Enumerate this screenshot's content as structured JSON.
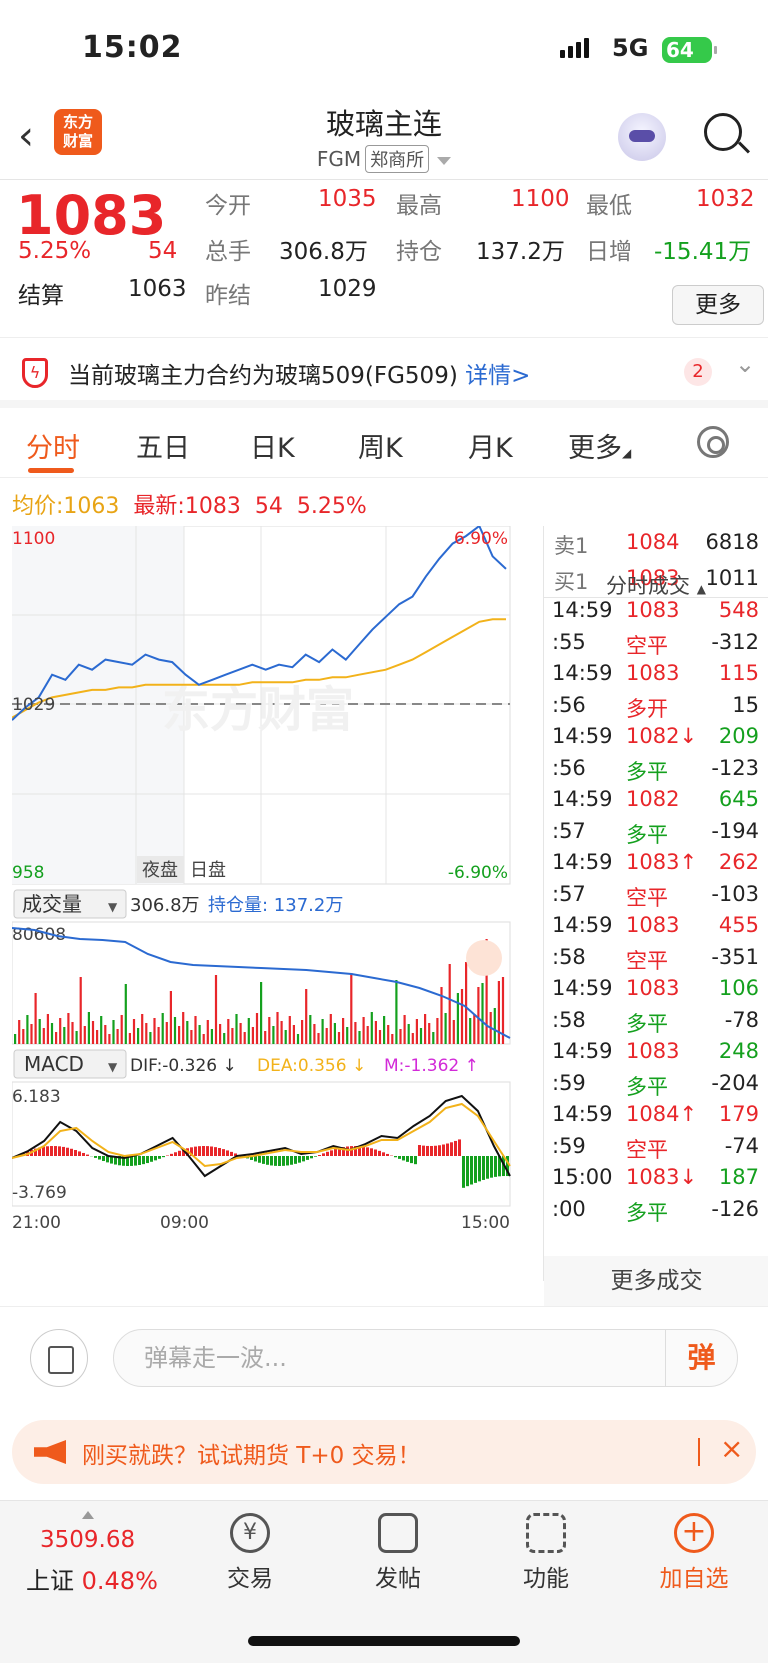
{
  "status": {
    "time": "15:02",
    "network": "5G",
    "battery": "64"
  },
  "header": {
    "logo_line1": "东方",
    "logo_line2": "财富",
    "title": "玻璃主连",
    "code": "FGM",
    "exchange": "郑商所"
  },
  "quote": {
    "price": "1083",
    "change_pct": "5.25%",
    "change": "54",
    "open_label": "今开",
    "open": "1035",
    "high_label": "最高",
    "high": "1100",
    "low_label": "最低",
    "low": "1032",
    "volume_label": "总手",
    "volume": "306.8万",
    "oi_label": "持仓",
    "oi": "137.2万",
    "daily_inc_label": "日增",
    "daily_inc": "-15.41万",
    "settle_label": "结算",
    "settle": "1063",
    "prev_settle_label": "昨结",
    "prev_settle": "1029",
    "more_label": "更多"
  },
  "notice": {
    "text": "当前玻璃主力合约为玻璃509(FG509)",
    "link": "详情>",
    "badge": "2"
  },
  "tabs": [
    "分时",
    "五日",
    "日K",
    "周K",
    "月K",
    "更多"
  ],
  "infoline": {
    "avg_label": "均价:",
    "avg": "1063",
    "latest_label": "最新:",
    "latest": "1083",
    "chg": "54",
    "pct": "5.25%"
  },
  "chart_labels": {
    "top_price": "1100",
    "top_pct": "6.90%",
    "base_price": "1029",
    "bottom_price": "958",
    "bottom_pct": "-6.90%",
    "night": "夜盘",
    "day": "日盘",
    "watermark": "东方财富",
    "vol_selector": "成交量",
    "vol_value": "306.8万",
    "oi_text": "持仓量: 137.2万",
    "vol_max": "80608",
    "macd_selector": "MACD",
    "dif": "DIF:-0.326 ↓",
    "dea": "DEA:0.356 ↓",
    "m": "M:-1.362 ↑",
    "macd_top": "6.183",
    "macd_bottom": "-3.769",
    "time_start": "21:00",
    "time_mid": "09:00",
    "time_end": "15:00"
  },
  "chart_data": {
    "type": "line",
    "title": "",
    "x_ticks": [
      "21:00",
      "09:00",
      "15:00"
    ],
    "ylim": [
      958,
      1100
    ],
    "reference": 1029,
    "series": [
      {
        "name": "",
        "color": "#2b6ad1",
        "values": [
          1023,
          1028,
          1032,
          1041,
          1039,
          1045,
          1043,
          1047,
          1046,
          1045,
          1049,
          1047,
          1046,
          1041,
          1037,
          1039,
          1041,
          1043,
          1045,
          1043,
          1045,
          1044,
          1049,
          1046,
          1051,
          1047,
          1053,
          1059,
          1064,
          1069,
          1072,
          1080,
          1087,
          1093,
          1096,
          1100,
          1088,
          1083
        ]
      },
      {
        "name": "",
        "color": "#f2b21a",
        "values": [
          1024,
          1027,
          1030,
          1032,
          1033,
          1034,
          1035,
          1035,
          1036,
          1036,
          1037,
          1037,
          1037,
          1037,
          1037,
          1037,
          1037,
          1037,
          1038,
          1038,
          1038,
          1038,
          1039,
          1039,
          1040,
          1040,
          1041,
          1042,
          1043,
          1045,
          1047,
          1050,
          1053,
          1056,
          1059,
          1062,
          1063,
          1063
        ]
      }
    ]
  },
  "orderbook": {
    "ask_label": "卖1",
    "ask_price": "1084",
    "ask_vol": "6818",
    "bid_label": "买1",
    "bid_price": "1083",
    "bid_vol": "1011"
  },
  "ticks_header": "分时成交",
  "ticks": [
    {
      "t": "14:59",
      "p": "1083",
      "pc": "red",
      "v": "548",
      "vc": "red"
    },
    {
      "t": ":55",
      "p": "空平",
      "pc": "red",
      "v": "-312",
      "vc": "dark"
    },
    {
      "t": "14:59",
      "p": "1083",
      "pc": "red",
      "v": "115",
      "vc": "red"
    },
    {
      "t": ":56",
      "p": "多开",
      "pc": "red",
      "v": "15",
      "vc": "dark"
    },
    {
      "t": "14:59",
      "p": "1082↓",
      "pc": "red",
      "v": "209",
      "vc": "green"
    },
    {
      "t": ":56",
      "p": "多平",
      "pc": "green",
      "v": "-123",
      "vc": "dark"
    },
    {
      "t": "14:59",
      "p": "1082",
      "pc": "red",
      "v": "645",
      "vc": "green"
    },
    {
      "t": ":57",
      "p": "多平",
      "pc": "green",
      "v": "-194",
      "vc": "dark"
    },
    {
      "t": "14:59",
      "p": "1083↑",
      "pc": "red",
      "v": "262",
      "vc": "red"
    },
    {
      "t": ":57",
      "p": "空平",
      "pc": "red",
      "v": "-103",
      "vc": "dark"
    },
    {
      "t": "14:59",
      "p": "1083",
      "pc": "red",
      "v": "455",
      "vc": "red"
    },
    {
      "t": ":58",
      "p": "空平",
      "pc": "red",
      "v": "-351",
      "vc": "dark"
    },
    {
      "t": "14:59",
      "p": "1083",
      "pc": "red",
      "v": "106",
      "vc": "green"
    },
    {
      "t": ":58",
      "p": "多平",
      "pc": "green",
      "v": "-78",
      "vc": "dark"
    },
    {
      "t": "14:59",
      "p": "1083",
      "pc": "red",
      "v": "248",
      "vc": "green"
    },
    {
      "t": ":59",
      "p": "多平",
      "pc": "green",
      "v": "-204",
      "vc": "dark"
    },
    {
      "t": "14:59",
      "p": "1084↑",
      "pc": "red",
      "v": "179",
      "vc": "red"
    },
    {
      "t": ":59",
      "p": "空平",
      "pc": "red",
      "v": "-74",
      "vc": "dark"
    },
    {
      "t": "15:00",
      "p": "1083↓",
      "pc": "red",
      "v": "187",
      "vc": "green"
    },
    {
      "t": ":00",
      "p": "多平",
      "pc": "green",
      "v": "-126",
      "vc": "dark"
    }
  ],
  "more_trades": "更多成交",
  "danmaku": {
    "placeholder": "弹幕走一波...",
    "button": "弹"
  },
  "promo": {
    "text": "刚买就跌？试试期货 T+0 交易！",
    "close": "×"
  },
  "bottom": {
    "index_value": "3509.68",
    "index_name": "上证",
    "index_pct": "0.48%",
    "trade": "交易",
    "post": "发帖",
    "func": "功能",
    "add": "加自选"
  }
}
